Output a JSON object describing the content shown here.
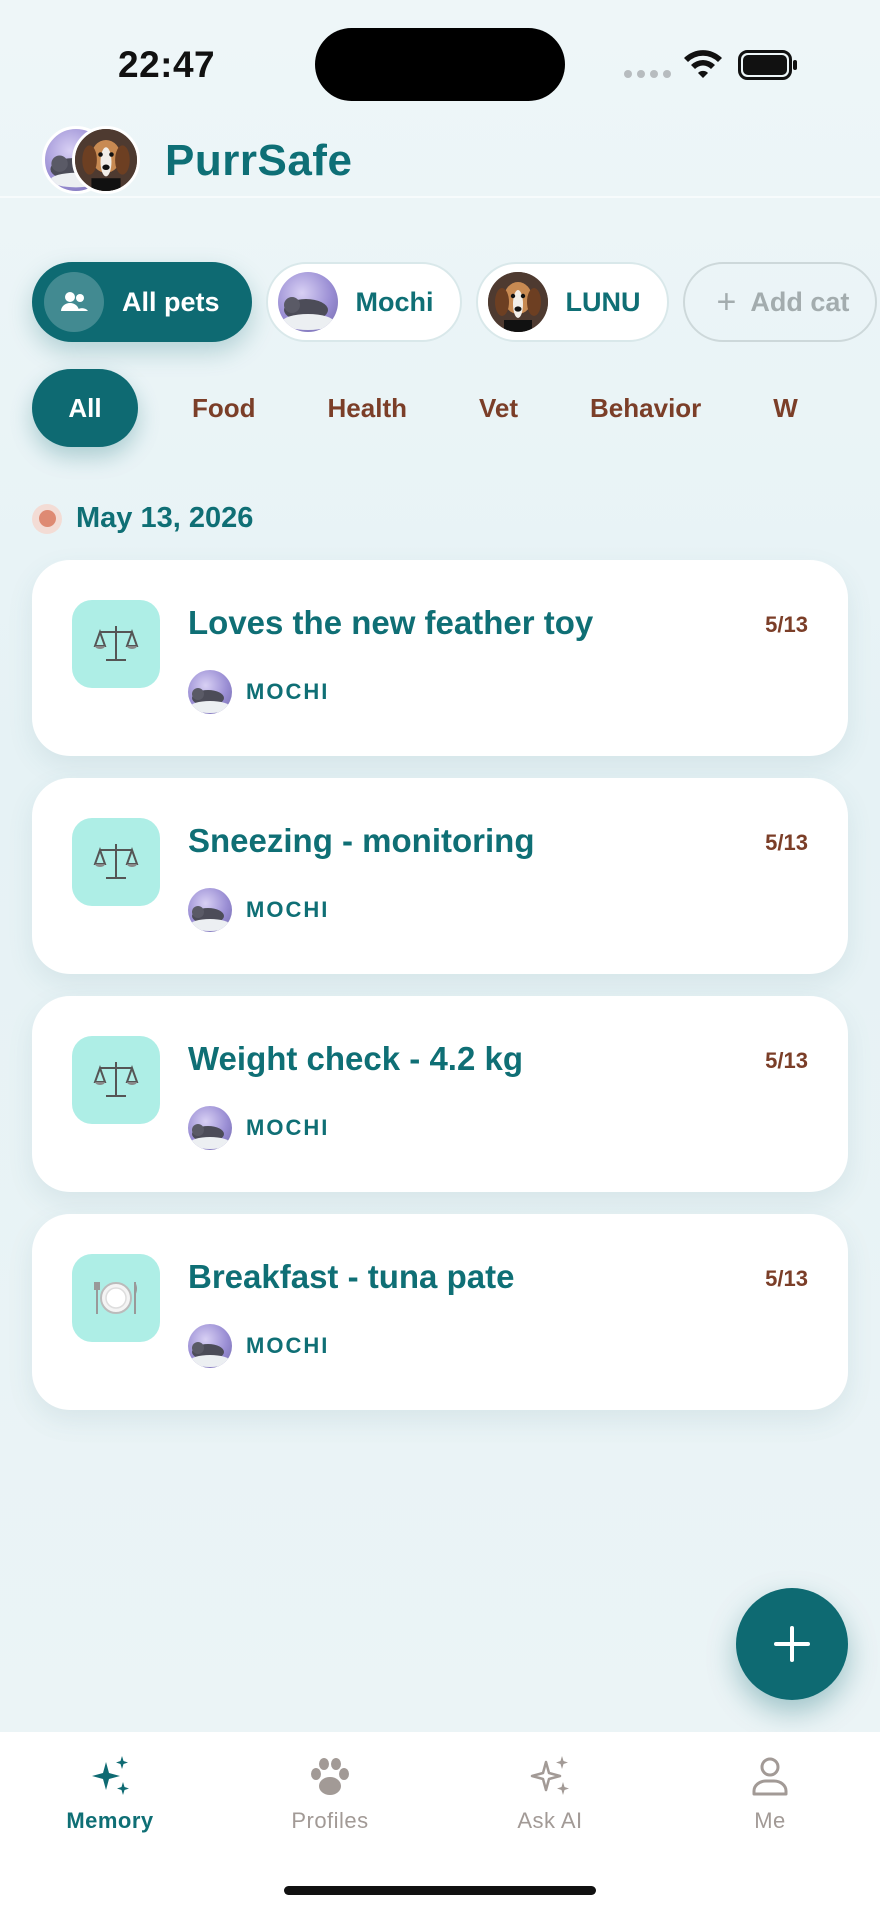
{
  "status_bar": {
    "time": "22:47"
  },
  "header": {
    "title": "PurrSafe"
  },
  "pet_filters": [
    {
      "label": "All pets",
      "active": true,
      "icon": "people-icon"
    },
    {
      "label": "Mochi",
      "active": false
    },
    {
      "label": "LUNU",
      "active": false
    },
    {
      "label": "Add cat",
      "active": false,
      "icon": "plus-icon"
    }
  ],
  "category_tabs": [
    "All",
    "Food",
    "Health",
    "Vet",
    "Behavior",
    "W"
  ],
  "active_category": "All",
  "timeline": {
    "date": "May 13, 2026",
    "entries": [
      {
        "title": "Loves the new feather toy",
        "date": "5/13",
        "pet": "MOCHI",
        "icon": "scale-icon"
      },
      {
        "title": "Sneezing - monitoring",
        "date": "5/13",
        "pet": "MOCHI",
        "icon": "scale-icon"
      },
      {
        "title": "Weight check - 4.2 kg",
        "date": "5/13",
        "pet": "MOCHI",
        "icon": "scale-icon"
      },
      {
        "title": "Breakfast - tuna pate",
        "date": "5/13",
        "pet": "MOCHI",
        "icon": "plate-icon"
      }
    ]
  },
  "bottom_nav": [
    {
      "label": "Memory",
      "active": true,
      "icon": "sparkles-icon"
    },
    {
      "label": "Profiles",
      "active": false,
      "icon": "paw-icon"
    },
    {
      "label": "Ask AI",
      "active": false,
      "icon": "sparkles-icon"
    },
    {
      "label": "Me",
      "active": false,
      "icon": "person-icon"
    }
  ],
  "colors": {
    "primary": "#0e6a72",
    "accent_brown": "#7b3e28",
    "icon_bg": "#aeeee6"
  }
}
